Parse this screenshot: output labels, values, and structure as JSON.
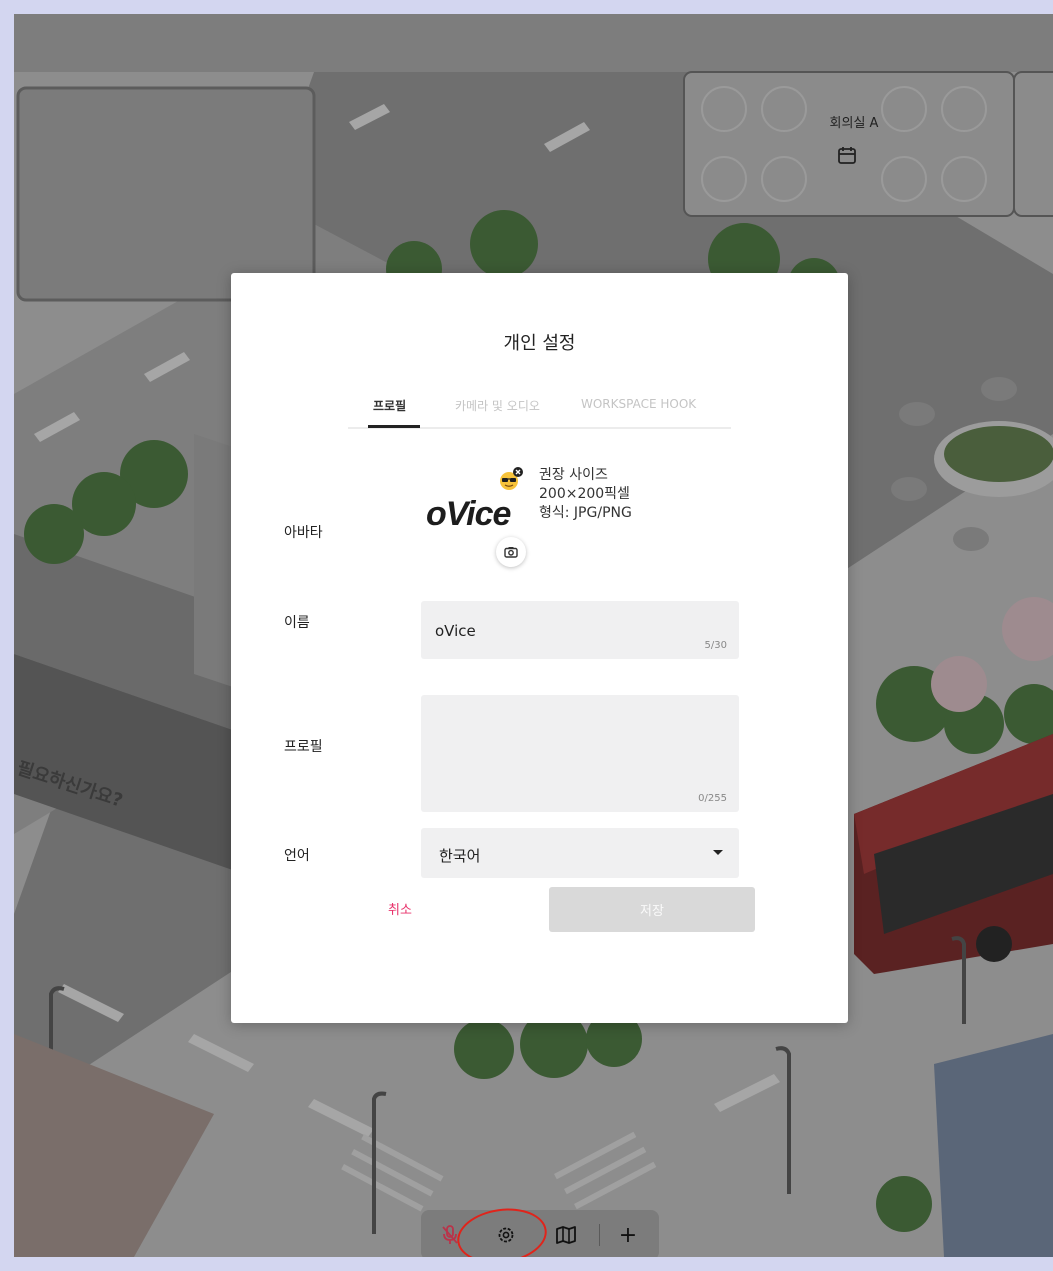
{
  "map": {
    "room_label": "회의실 A",
    "shop_sign": "필요하신가요?"
  },
  "modal": {
    "title": "개인 설정",
    "tabs": [
      {
        "label": "프로필",
        "active": true
      },
      {
        "label": "카메라 및 오디오",
        "active": false
      },
      {
        "label": "WORKSPACE HOOK",
        "active": false
      }
    ],
    "avatar": {
      "label": "아바타",
      "logo_text": "oVice",
      "info_line1": "권장 사이즈",
      "info_line2": "200×200픽셀",
      "info_line3": "형식: JPG/PNG"
    },
    "name": {
      "label": "이름",
      "value": "oVice",
      "counter": "5/30"
    },
    "profile": {
      "label": "프로필",
      "value": "",
      "counter": "0/255"
    },
    "language": {
      "label": "언어",
      "value": "한국어"
    },
    "cancel_label": "취소",
    "save_label": "저장"
  },
  "toolbar": {
    "icons": [
      "mic-off-icon",
      "gear-icon",
      "map-icon",
      "plus-icon"
    ],
    "plus_label": "+"
  },
  "colors": {
    "accent_cancel": "#e8326b",
    "highlight_ring": "#e0241b",
    "page_border": "#d3d6f0"
  }
}
